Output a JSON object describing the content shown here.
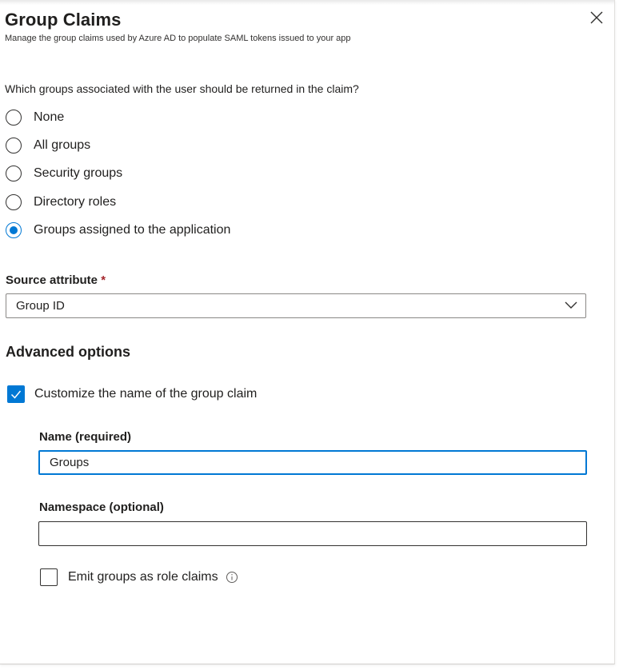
{
  "header": {
    "title": "Group Claims",
    "subtitle": "Manage the group claims used by Azure AD to populate SAML tokens issued to your app"
  },
  "groups_question": "Which groups associated with the user should be returned in the claim?",
  "group_options": [
    {
      "label": "None",
      "selected": false
    },
    {
      "label": "All groups",
      "selected": false
    },
    {
      "label": "Security groups",
      "selected": false
    },
    {
      "label": "Directory roles",
      "selected": false
    },
    {
      "label": "Groups assigned to the application",
      "selected": true
    }
  ],
  "source_attribute": {
    "label": "Source attribute",
    "required_mark": "*",
    "value": "Group ID"
  },
  "advanced": {
    "title": "Advanced options",
    "customize_label": "Customize the name of the group claim",
    "customize_checked": true,
    "name_label": "Name (required)",
    "name_value": "Groups",
    "namespace_label": "Namespace (optional)",
    "namespace_value": "",
    "emit_label": "Emit groups as role claims",
    "emit_checked": false
  },
  "colors": {
    "accent": "#0078d4",
    "required": "#a4262c"
  },
  "icons": {
    "close": "close-icon",
    "dropdown": "chevron-down-icon",
    "info": "info-icon",
    "check": "checkmark-icon"
  }
}
